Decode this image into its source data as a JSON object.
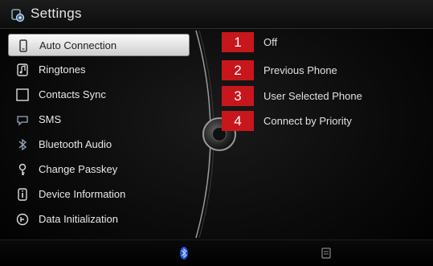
{
  "title": "Settings",
  "menu": {
    "items": [
      {
        "label": "Auto Connection",
        "icon": "phone-link-icon",
        "selected": true
      },
      {
        "label": "Ringtones",
        "icon": "music-note-icon",
        "selected": false
      },
      {
        "label": "Contacts Sync",
        "icon": "contacts-icon",
        "selected": false
      },
      {
        "label": "SMS",
        "icon": "message-icon",
        "selected": false
      },
      {
        "label": "Bluetooth Audio",
        "icon": "bluetooth-audio-icon",
        "selected": false
      },
      {
        "label": "Change Passkey",
        "icon": "key-icon",
        "selected": false
      },
      {
        "label": "Device Information",
        "icon": "info-icon",
        "selected": false
      },
      {
        "label": "Data Initialization",
        "icon": "reset-icon",
        "selected": false
      }
    ]
  },
  "options": [
    {
      "number": "1",
      "label": "Off"
    },
    {
      "number": "2",
      "label": "Previous Phone"
    },
    {
      "number": "3",
      "label": "User Selected Phone"
    },
    {
      "number": "4",
      "label": "Connect by Priority"
    }
  ],
  "colors": {
    "badge": "#c8161d",
    "selected_bg": "#eeeeee",
    "bluetooth": "#3a7bff"
  }
}
